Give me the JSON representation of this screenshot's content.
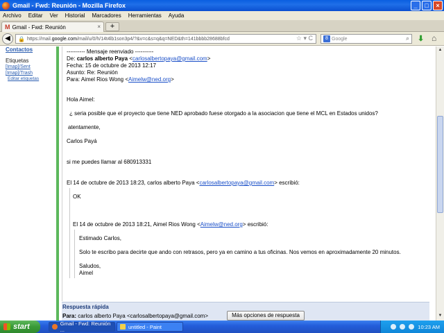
{
  "window": {
    "title": "Gmail - Fwd: Reunión - Mozilla Firefox",
    "controls": [
      "_",
      "□",
      "×"
    ]
  },
  "menu": [
    "Archivo",
    "Editar",
    "Ver",
    "Historial",
    "Marcadores",
    "Herramientas",
    "Ayuda"
  ],
  "tab": {
    "label": "Gmail - Fwd: Reunión",
    "close": "×",
    "new_tab": "+"
  },
  "nav": {
    "url_prefix": "https://mail.",
    "url_host": "google.com",
    "url_rest": "/mail/u/0/h/14t4lb1son3p4/?&v=c&s=q&q=NED&th=141bbbb28688bfcd",
    "search_placeholder": "Google"
  },
  "sidebar": {
    "contacts": "Contactos",
    "labels_heading": "Etiquetas",
    "labels": [
      "[Imap]/Sent",
      "[Imap]/Trash"
    ],
    "edit_labels": "Editar etiquetas"
  },
  "message": {
    "fwd_marker": "---------- Mensaje reenviado ----------",
    "from_label": "De:",
    "from_name": "carlos alberto Paya",
    "from_email": "carlosalbertopaya@gmail.com",
    "date": "Fecha: 15 de octubre de 2013 12:17",
    "subject": "Asunto: Re: Reunión",
    "to_label": "Para: Aimel Rios Wong <",
    "to_email": "Aimelw@ned.org",
    "greeting": "Hola  Aimel:",
    "question": "¿ seria posible  que el proyecto que tiene NED aprobado fuese  otorgado a la asociacion que tiene el MCL en Estados unidos?",
    "closing": "atentamente,",
    "signature": "Carlos Payá",
    "phone_line": "si me puedes llamar al 680913331",
    "reply1_header_pre": "El 14 de octubre de 2013 18:23, carlos alberto Paya <",
    "reply1_email": "carlosalbertopaya@gmail.com",
    "reply1_header_post": "> escribió:",
    "reply1_body": "OK",
    "reply2_header_pre": "El 14 de octubre de 2013 18:21, Aimel Rios Wong <",
    "reply2_email": "Aimelw@ned.org",
    "reply2_header_post": "> escribió:",
    "reply2_greeting": "Estimado Carlos,",
    "reply2_body": "Solo te escribo para decirte que ando con retrasos, pero ya en camino a tus oficinas. Nos vemos en aproximadamente 20 minutos.",
    "reply2_closing": "Saludos,",
    "reply2_signature": "Aimel"
  },
  "quick_reply": {
    "title": "Respuesta rápida",
    "to_label": "Para:",
    "to_value": "carlos alberto Paya <carlosalbertopaya@gmail.com>",
    "more_options": "Más opciones de respuesta"
  },
  "taskbar": {
    "start": "start",
    "tasks": [
      "Gmail - Fwd: Reunión ...",
      "untitled - Paint"
    ],
    "clock": "10:23 AM"
  }
}
